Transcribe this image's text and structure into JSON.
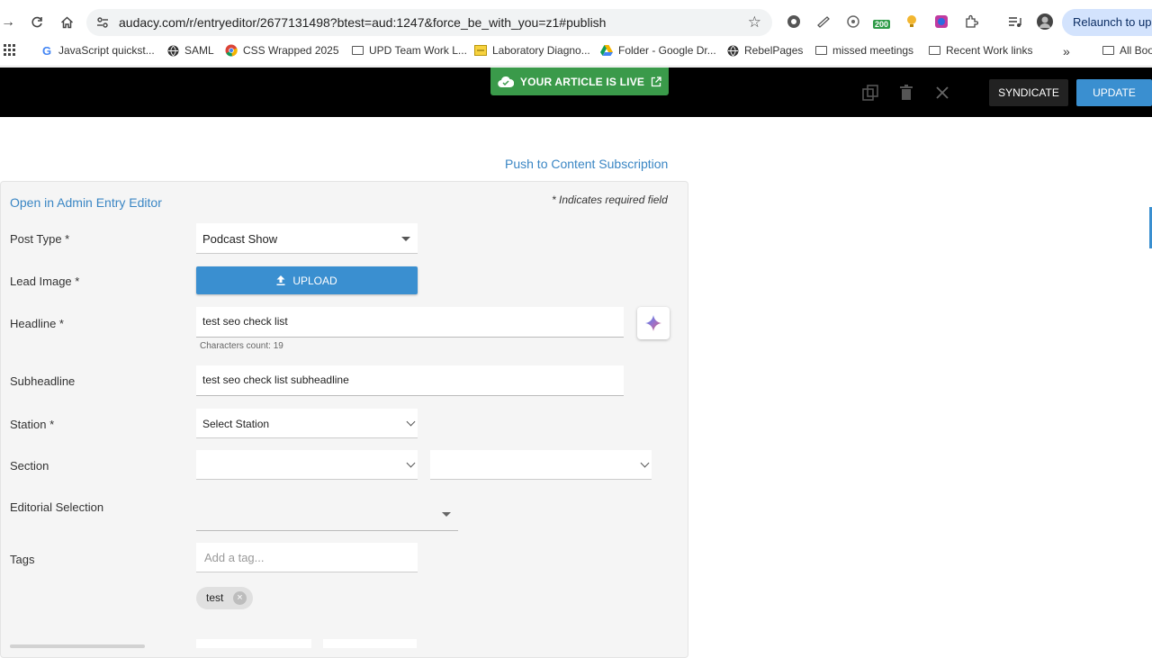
{
  "browser": {
    "url": "audacy.com/r/entryeditor/2677131498?btest=aud:1247&force_be_with_you=z1#publish",
    "relaunch_label": "Relaunch to upd",
    "ext_badge": "200",
    "bookmarks": [
      {
        "label": "JavaScript quickst...",
        "icon": "google-icon"
      },
      {
        "label": "SAML",
        "icon": "globe-icon"
      },
      {
        "label": "CSS Wrapped 2025",
        "icon": "chrome-icon"
      },
      {
        "label": "UPD Team Work L...",
        "icon": "folder-icon"
      },
      {
        "label": "Laboratory Diagno...",
        "icon": "doc-icon"
      },
      {
        "label": "Folder - Google Dr...",
        "icon": "drive-icon"
      },
      {
        "label": "RebelPages",
        "icon": "globe-icon"
      },
      {
        "label": "missed meetings",
        "icon": "folder-icon"
      },
      {
        "label": "Recent Work links",
        "icon": "folder-icon"
      }
    ],
    "all_bookmarks_label": "All Boo"
  },
  "header": {
    "live_badge": "YOUR ARTICLE IS LIVE",
    "syndicate_label": "SYNDICATE",
    "update_label": "UPDATE"
  },
  "form": {
    "push_link": "Push to Content Subscription",
    "admin_link": "Open in Admin Entry Editor",
    "required_note": "* Indicates required field",
    "post_type": {
      "label": "Post Type *",
      "value": "Podcast Show"
    },
    "lead_image": {
      "label": "Lead Image *",
      "button": "UPLOAD"
    },
    "headline": {
      "label": "Headline *",
      "value": "test seo check list",
      "char_count": "Characters count: 19"
    },
    "subheadline": {
      "label": "Subheadline",
      "value": "test seo check list subheadline"
    },
    "station": {
      "label": "Station *",
      "value": "Select Station"
    },
    "section": {
      "label": "Section",
      "value1": "",
      "value2": ""
    },
    "editorial": {
      "label": "Editorial Selection",
      "value": ""
    },
    "tags": {
      "label": "Tags",
      "placeholder": "Add a tag...",
      "chips": [
        "test"
      ]
    }
  },
  "colors": {
    "accent": "#3a8fd0",
    "live": "#3a9a4a",
    "link": "#3a86c4"
  }
}
